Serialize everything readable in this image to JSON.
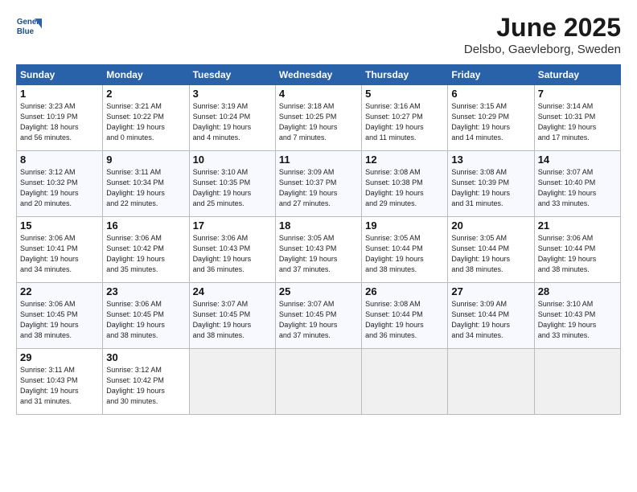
{
  "header": {
    "logo_line1": "General",
    "logo_line2": "Blue",
    "month": "June 2025",
    "location": "Delsbo, Gaevleborg, Sweden"
  },
  "days_of_week": [
    "Sunday",
    "Monday",
    "Tuesday",
    "Wednesday",
    "Thursday",
    "Friday",
    "Saturday"
  ],
  "weeks": [
    [
      {
        "day": "1",
        "info": "Sunrise: 3:23 AM\nSunset: 10:19 PM\nDaylight: 18 hours\nand 56 minutes."
      },
      {
        "day": "2",
        "info": "Sunrise: 3:21 AM\nSunset: 10:22 PM\nDaylight: 19 hours\nand 0 minutes."
      },
      {
        "day": "3",
        "info": "Sunrise: 3:19 AM\nSunset: 10:24 PM\nDaylight: 19 hours\nand 4 minutes."
      },
      {
        "day": "4",
        "info": "Sunrise: 3:18 AM\nSunset: 10:25 PM\nDaylight: 19 hours\nand 7 minutes."
      },
      {
        "day": "5",
        "info": "Sunrise: 3:16 AM\nSunset: 10:27 PM\nDaylight: 19 hours\nand 11 minutes."
      },
      {
        "day": "6",
        "info": "Sunrise: 3:15 AM\nSunset: 10:29 PM\nDaylight: 19 hours\nand 14 minutes."
      },
      {
        "day": "7",
        "info": "Sunrise: 3:14 AM\nSunset: 10:31 PM\nDaylight: 19 hours\nand 17 minutes."
      }
    ],
    [
      {
        "day": "8",
        "info": "Sunrise: 3:12 AM\nSunset: 10:32 PM\nDaylight: 19 hours\nand 20 minutes."
      },
      {
        "day": "9",
        "info": "Sunrise: 3:11 AM\nSunset: 10:34 PM\nDaylight: 19 hours\nand 22 minutes."
      },
      {
        "day": "10",
        "info": "Sunrise: 3:10 AM\nSunset: 10:35 PM\nDaylight: 19 hours\nand 25 minutes."
      },
      {
        "day": "11",
        "info": "Sunrise: 3:09 AM\nSunset: 10:37 PM\nDaylight: 19 hours\nand 27 minutes."
      },
      {
        "day": "12",
        "info": "Sunrise: 3:08 AM\nSunset: 10:38 PM\nDaylight: 19 hours\nand 29 minutes."
      },
      {
        "day": "13",
        "info": "Sunrise: 3:08 AM\nSunset: 10:39 PM\nDaylight: 19 hours\nand 31 minutes."
      },
      {
        "day": "14",
        "info": "Sunrise: 3:07 AM\nSunset: 10:40 PM\nDaylight: 19 hours\nand 33 minutes."
      }
    ],
    [
      {
        "day": "15",
        "info": "Sunrise: 3:06 AM\nSunset: 10:41 PM\nDaylight: 19 hours\nand 34 minutes."
      },
      {
        "day": "16",
        "info": "Sunrise: 3:06 AM\nSunset: 10:42 PM\nDaylight: 19 hours\nand 35 minutes."
      },
      {
        "day": "17",
        "info": "Sunrise: 3:06 AM\nSunset: 10:43 PM\nDaylight: 19 hours\nand 36 minutes."
      },
      {
        "day": "18",
        "info": "Sunrise: 3:05 AM\nSunset: 10:43 PM\nDaylight: 19 hours\nand 37 minutes."
      },
      {
        "day": "19",
        "info": "Sunrise: 3:05 AM\nSunset: 10:44 PM\nDaylight: 19 hours\nand 38 minutes."
      },
      {
        "day": "20",
        "info": "Sunrise: 3:05 AM\nSunset: 10:44 PM\nDaylight: 19 hours\nand 38 minutes."
      },
      {
        "day": "21",
        "info": "Sunrise: 3:06 AM\nSunset: 10:44 PM\nDaylight: 19 hours\nand 38 minutes."
      }
    ],
    [
      {
        "day": "22",
        "info": "Sunrise: 3:06 AM\nSunset: 10:45 PM\nDaylight: 19 hours\nand 38 minutes."
      },
      {
        "day": "23",
        "info": "Sunrise: 3:06 AM\nSunset: 10:45 PM\nDaylight: 19 hours\nand 38 minutes."
      },
      {
        "day": "24",
        "info": "Sunrise: 3:07 AM\nSunset: 10:45 PM\nDaylight: 19 hours\nand 38 minutes."
      },
      {
        "day": "25",
        "info": "Sunrise: 3:07 AM\nSunset: 10:45 PM\nDaylight: 19 hours\nand 37 minutes."
      },
      {
        "day": "26",
        "info": "Sunrise: 3:08 AM\nSunset: 10:44 PM\nDaylight: 19 hours\nand 36 minutes."
      },
      {
        "day": "27",
        "info": "Sunrise: 3:09 AM\nSunset: 10:44 PM\nDaylight: 19 hours\nand 34 minutes."
      },
      {
        "day": "28",
        "info": "Sunrise: 3:10 AM\nSunset: 10:43 PM\nDaylight: 19 hours\nand 33 minutes."
      }
    ],
    [
      {
        "day": "29",
        "info": "Sunrise: 3:11 AM\nSunset: 10:43 PM\nDaylight: 19 hours\nand 31 minutes."
      },
      {
        "day": "30",
        "info": "Sunrise: 3:12 AM\nSunset: 10:42 PM\nDaylight: 19 hours\nand 30 minutes."
      },
      {
        "day": "",
        "info": ""
      },
      {
        "day": "",
        "info": ""
      },
      {
        "day": "",
        "info": ""
      },
      {
        "day": "",
        "info": ""
      },
      {
        "day": "",
        "info": ""
      }
    ]
  ]
}
